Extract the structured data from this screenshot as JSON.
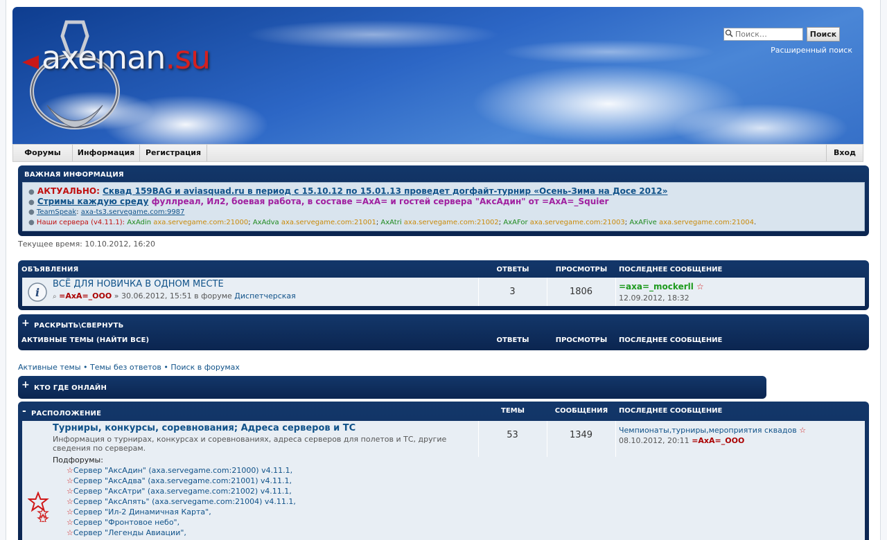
{
  "logo": {
    "text_main": "axeman",
    "text_suffix": ".su"
  },
  "search": {
    "placeholder": "Поиск…",
    "button": "Поиск",
    "advanced": "Расширенный поиск"
  },
  "nav": {
    "forums": "Форумы",
    "info": "Информация",
    "register": "Регистрация",
    "login": "Вход"
  },
  "important": {
    "title": "ВАЖНАЯ ИНФОРМАЦИЯ",
    "line1_prefix": "АКТУАЛЬНО:",
    "line1_link": "Сквад 159BAG и aviasquad.ru в период с 15.10.12 по 15.01.13 проведет догфайт-турнир «Осень-Зима на Досе 2012»",
    "line2_link": "Стримы каждую среду",
    "line2_text": "фуллреал, Ил2, боевая работа, в составе =АхА= и гостей сервера \"АксАдин\" от =АхА=_Squier",
    "line3_label": "TeamSpeak",
    "line3_sep": ":",
    "line3_value": "axa-ts3.servegame.com:9987",
    "line4_label": "Наши сервера (v4.11.1):",
    "servers": [
      {
        "name": "AxAdin",
        "addr": "axa.servegame.com:21000",
        "sep": ";"
      },
      {
        "name": "AxAdva",
        "addr": "axa.servegame.com:21001",
        "sep": ";"
      },
      {
        "name": "AxAtri",
        "addr": "axa.servegame.com:21002",
        "sep": ";"
      },
      {
        "name": "AxAFor",
        "addr": "axa.servegame.com:21003",
        "sep": ";"
      },
      {
        "name": "AxAFive",
        "addr": "axa.servegame.com:21004",
        "sep": "."
      }
    ]
  },
  "current_time": "Текущее время: 10.10.2012, 16:20",
  "announcements": {
    "title": "ОБЪЯВЛЕНИЯ",
    "col_replies": "ОТВЕТЫ",
    "col_views": "ПРОСМОТРЫ",
    "col_last": "ПОСЛЕДНЕЕ СООБЩЕНИЕ",
    "topic": {
      "title": "ВСЁ ДЛЯ НОВИЧКА В ОДНОМ МЕСТЕ",
      "author": "=AxA=_OOO",
      "meta": "» 30.06.2012, 15:51 в форуме",
      "forum": "Диспетчерская",
      "replies": "3",
      "views": "1806",
      "last_author": "=axa=_mockerll",
      "last_date": "12.09.2012, 18:32"
    }
  },
  "active": {
    "toggle": "РАСКРЫТЬ\\СВЕРНУТЬ",
    "title": "АКТИВНЫЕ ТЕМЫ (НАЙТИ ВСЕ)",
    "col_replies": "ОТВЕТЫ",
    "col_views": "ПРОСМОТРЫ",
    "col_last": "ПОСЛЕДНЕЕ СООБЩЕНИЕ"
  },
  "quick_links": {
    "active": "Активные темы",
    "unanswered": "Темы без ответов",
    "search": "Поиск в форумах",
    "sep": "•"
  },
  "online": {
    "title": "КТО ГДЕ ОНЛАЙН"
  },
  "location": {
    "title": "РАСПОЛОЖЕНИЕ",
    "col_topics": "ТЕМЫ",
    "col_posts": "СООБЩЕНИЯ",
    "col_last": "ПОСЛЕДНЕЕ СООБЩЕНИЕ",
    "forum": {
      "title": "Турниры, конкурсы, соревнования; Адреса серверов и ТС",
      "desc_line1": "Информация о турнирах, конкурсах и соревнованиях, адреса серверов для полетов и ТС, другие",
      "desc_line2": "сведения по серверам.",
      "subforums_label": "Подфорумы:",
      "subforums": [
        "Сервер \"АксАдин\" (axa.servegame.com:21000) v4.11.1,",
        "Сервер \"АксАдва\" (axa.servegame.com:21001) v4.11.1,",
        "Сервер \"АксАтри\" (axa.servegame.com:21002) v4.11.1,",
        "Сервер \"АксАпять\" (axa.servegame.com:21004) v4.11.1,",
        "Сервер \"Ил-2 Динамичная Карта\",",
        "Сервер \"Фронтовое небо\",",
        "Сервер \"Легенды Авиации\","
      ],
      "topics": "53",
      "posts": "1349",
      "last_title": "Чемпионаты,турниры,мероприятия сквадов",
      "last_date": "08.10.2012, 20:11",
      "last_author": "=AxA=_OOO"
    }
  }
}
